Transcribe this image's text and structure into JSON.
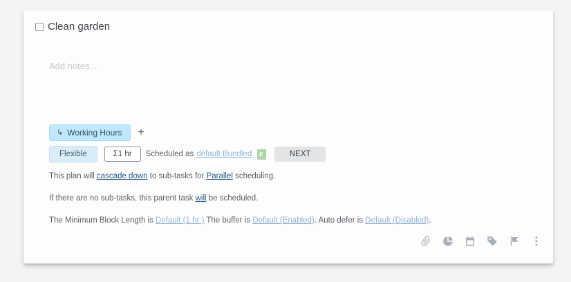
{
  "task": {
    "title": "Clean garden",
    "notes_placeholder": "Add notes..."
  },
  "tag": {
    "arrow": "↳",
    "label": "Working Hours",
    "add_label": "+"
  },
  "schedule": {
    "mode_label": "Flexible",
    "duration_label": "Σ1 hr",
    "scheduled_as_label": "Scheduled as",
    "scheduled_as_link": "default Bundled",
    "next_label": "NEXT"
  },
  "info": {
    "cascade": {
      "pre": "This plan will ",
      "link1": "cascade down",
      "mid": " to sub-tasks for ",
      "link2": "Parallel",
      "post": " scheduling."
    },
    "parent": {
      "pre": "If there are no sub-tasks, this parent task ",
      "link": "will",
      "post": " be scheduled."
    },
    "block": {
      "pre": "The Minimum Block Length is ",
      "link1": "Default (1 hr )",
      "mid1": " The buffer is ",
      "link2": "Default (Enabled)",
      "mid2": ". Auto defer is ",
      "link3": "Default (Disabled)",
      "post": "."
    }
  },
  "toolbar": {
    "icons": [
      "paperclip-icon",
      "pie-chart-icon",
      "calendar-icon",
      "tag-icon",
      "flag-icon",
      "more-vertical-icon"
    ]
  },
  "colors": {
    "tag_bg": "#bfe9fb",
    "flexible_bg": "#d9ecf8",
    "link": "#2b5a86",
    "link_muted": "#8fb4d4",
    "icon": "#aab0b8"
  }
}
